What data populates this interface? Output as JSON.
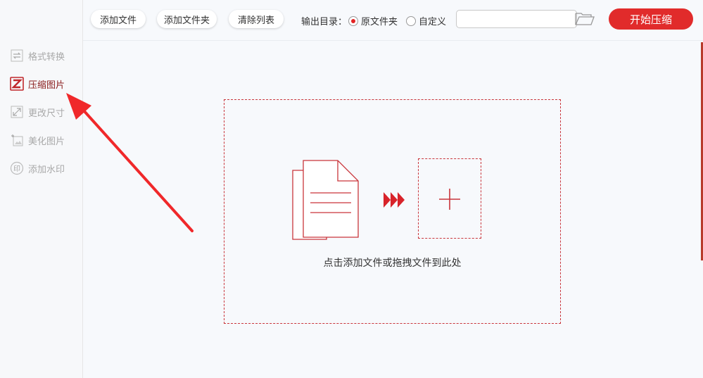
{
  "sidebar": {
    "items": [
      {
        "label": "格式转换",
        "icon": "swap-arrows-icon",
        "active": false
      },
      {
        "label": "压缩图片",
        "icon": "compress-image-icon",
        "active": true
      },
      {
        "label": "更改尺寸",
        "icon": "resize-icon",
        "active": false
      },
      {
        "label": "美化图片",
        "icon": "beautify-image-icon",
        "active": false
      },
      {
        "label": "添加水印",
        "icon": "watermark-stamp-icon",
        "active": false
      }
    ]
  },
  "toolbar": {
    "add_file": "添加文件",
    "add_folder": "添加文件夹",
    "clear_list": "清除列表",
    "output_label": "输出目录：",
    "radio_original": "原文件夹",
    "radio_custom": "自定义",
    "selected_output": "原文件夹",
    "path_value": "",
    "start_button": "开始压缩"
  },
  "dropzone": {
    "hint": "点击添加文件或拖拽文件到此处"
  },
  "colors": {
    "accent": "#e12b2b",
    "dashed_border": "#c9353b",
    "inactive_text": "#a9a9a9",
    "active_text": "#8a1c1c"
  }
}
